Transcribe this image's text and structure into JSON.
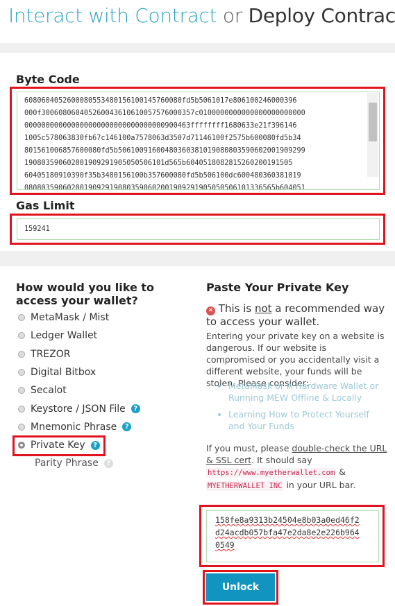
{
  "header": {
    "interact": "Interact with Contract",
    "or": "or",
    "deploy": "Deploy Contract"
  },
  "bytecode": {
    "label": "Byte Code",
    "lines": [
      "6080604052600080553480156100145760080fd5b5061017e806100246000396",
      "000f300608060405260043610610057576000357c0100000000000000000000000",
      "000000000000000000000000000000000900463ffffffff1680633e21f396146",
      "1005c578063830fb67c146100a7578063d3507d71146100f2575b600080fd5b34",
      "801561006857600080fd5b50610091600480360381019080803590602001909299",
      "190803590602001909291905050506101d565b6040518082815260200191505",
      "60405180910390f35b3480156100b357600080fd5b506100dc600480360381019",
      "08080359060200190929190803590602001909291905050506101336565b604051"
    ]
  },
  "gas": {
    "label": "Gas Limit",
    "value": "159241"
  },
  "access": {
    "title": "How would you like to access your wallet?",
    "options": [
      {
        "label": "MetaMask / Mist"
      },
      {
        "label": "Ledger Wallet"
      },
      {
        "label": "TREZOR"
      },
      {
        "label": "Digital Bitbox"
      },
      {
        "label": "Secalot"
      },
      {
        "label": "Keystore / JSON File",
        "help": "?"
      },
      {
        "label": "Mnemonic Phrase",
        "help": "?"
      },
      {
        "label": "Private Key",
        "help": "?",
        "selected": true
      }
    ],
    "parity": "Parity Phrase"
  },
  "privkey": {
    "title": "Paste Your Private Key",
    "warn1": "This is ",
    "warn_not": "not",
    "warn2": " a recommended way to access your wallet.",
    "para": "Entering your private key on a website is dangerous. If our website is compromised or you accidentally visit a different website, your funds will be stolen. Please consider:",
    "bullets": [
      "MetaMask or A Hardware Wallet or Running MEW Offline & Locally",
      "Learning How to Protect Yourself and Your Funds"
    ],
    "must1": "If you must, please ",
    "must_link": "double-check the URL & SSL cert",
    "must2": ". It should say ",
    "url": "https://www.myetherwallet.com",
    "amp": " & ",
    "inc": "MYETHERWALLET INC",
    "must3": " in your URL bar.",
    "value": "158fe8a9313b24504e8b03a0ed46f2\nd24acdb057bfa47e2da8e2e226b964\n0549",
    "unlock": "Unlock"
  },
  "colors": {
    "accent": "#2aa1c0",
    "button": "#1195c0",
    "highlight": "#e0131f"
  }
}
